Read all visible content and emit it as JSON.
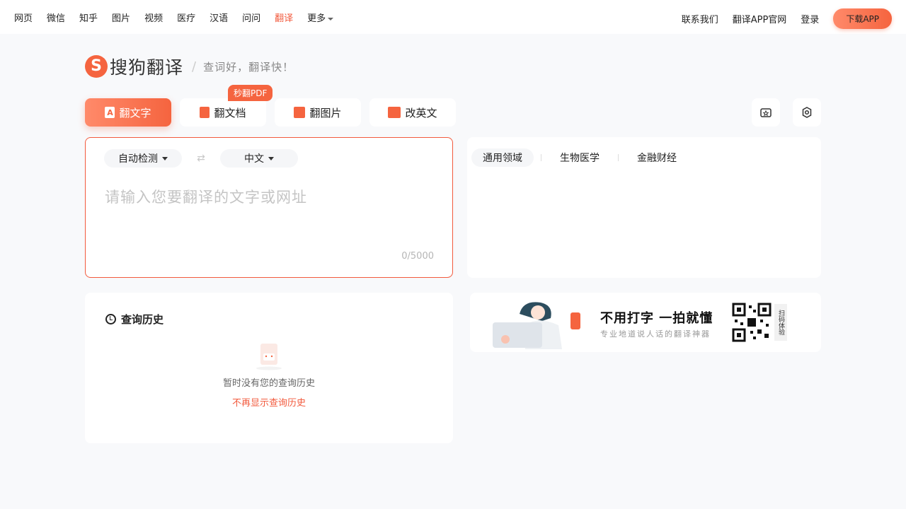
{
  "topnav": {
    "links": [
      "网页",
      "微信",
      "知乎",
      "图片",
      "视频",
      "医疗",
      "汉语",
      "问问",
      "翻译"
    ],
    "more": "更多",
    "right": [
      "联系我们",
      "翻译APP官网",
      "登录"
    ],
    "download_btn": "下载APP"
  },
  "logo": {
    "text": "搜狗翻译",
    "slogan": "查词好，翻译快！"
  },
  "tabs": [
    {
      "label": "翻文字",
      "icon": "text-a-icon"
    },
    {
      "label": "翻文档",
      "icon": "document-icon"
    },
    {
      "label": "翻图片",
      "icon": "image-icon"
    },
    {
      "label": "改英文",
      "icon": "edit-english-icon"
    }
  ],
  "pdf_badge": "秒翻PDF",
  "translator": {
    "source_lang": "自动检测",
    "target_lang": "中文",
    "swap_icon": "⇄",
    "placeholder": "请输入您要翻译的文字或网址",
    "counter": "0/5000"
  },
  "domains": [
    "通用领域",
    "生物医学",
    "金融财经"
  ],
  "history": {
    "title": "查询历史",
    "empty": "暂时没有您的查询历史",
    "hide_link": "不再显示查询历史"
  },
  "banner": {
    "title": "不用打字 一拍就懂",
    "subtitle": "专业地道说人话的翻译神器",
    "qr_tag": "扫码体验"
  },
  "colors": {
    "accent": "#f5643f",
    "active_text": "#f25a3d"
  }
}
